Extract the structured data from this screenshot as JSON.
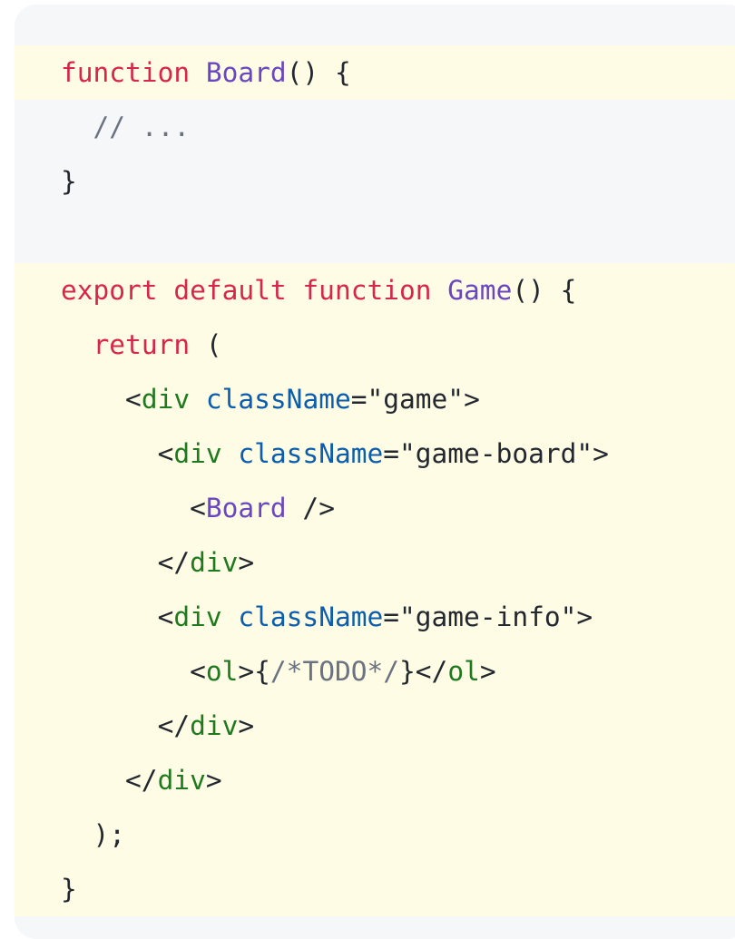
{
  "code_block": {
    "lines": [
      {
        "highlighted": true,
        "tokens": [
          {
            "text": "function ",
            "kind": "kw"
          },
          {
            "text": "Board",
            "kind": "fn"
          },
          {
            "text": "() {",
            "kind": "punc"
          }
        ]
      },
      {
        "highlighted": false,
        "tokens": [
          {
            "text": "  // ...",
            "kind": "com"
          }
        ]
      },
      {
        "highlighted": false,
        "tokens": [
          {
            "text": "}",
            "kind": "punc"
          }
        ]
      },
      {
        "highlighted": false,
        "tokens": []
      },
      {
        "highlighted": true,
        "tokens": [
          {
            "text": "export ",
            "kind": "kw"
          },
          {
            "text": "default ",
            "kind": "kw"
          },
          {
            "text": "function ",
            "kind": "kw"
          },
          {
            "text": "Game",
            "kind": "fn"
          },
          {
            "text": "() {",
            "kind": "punc"
          }
        ]
      },
      {
        "highlighted": true,
        "tokens": [
          {
            "text": "  ",
            "kind": "punc"
          },
          {
            "text": "return",
            "kind": "kw"
          },
          {
            "text": " (",
            "kind": "punc"
          }
        ]
      },
      {
        "highlighted": true,
        "tokens": [
          {
            "text": "    <",
            "kind": "punc"
          },
          {
            "text": "div",
            "kind": "tag"
          },
          {
            "text": " ",
            "kind": "punc"
          },
          {
            "text": "className",
            "kind": "attr"
          },
          {
            "text": "=",
            "kind": "punc"
          },
          {
            "text": "\"game\"",
            "kind": "str"
          },
          {
            "text": ">",
            "kind": "punc"
          }
        ]
      },
      {
        "highlighted": true,
        "tokens": [
          {
            "text": "      <",
            "kind": "punc"
          },
          {
            "text": "div",
            "kind": "tag"
          },
          {
            "text": " ",
            "kind": "punc"
          },
          {
            "text": "className",
            "kind": "attr"
          },
          {
            "text": "=",
            "kind": "punc"
          },
          {
            "text": "\"game-board\"",
            "kind": "str"
          },
          {
            "text": ">",
            "kind": "punc"
          }
        ]
      },
      {
        "highlighted": true,
        "tokens": [
          {
            "text": "        <",
            "kind": "punc"
          },
          {
            "text": "Board",
            "kind": "fn"
          },
          {
            "text": " />",
            "kind": "punc"
          }
        ]
      },
      {
        "highlighted": true,
        "tokens": [
          {
            "text": "      </",
            "kind": "punc"
          },
          {
            "text": "div",
            "kind": "tag"
          },
          {
            "text": ">",
            "kind": "punc"
          }
        ]
      },
      {
        "highlighted": true,
        "tokens": [
          {
            "text": "      <",
            "kind": "punc"
          },
          {
            "text": "div",
            "kind": "tag"
          },
          {
            "text": " ",
            "kind": "punc"
          },
          {
            "text": "className",
            "kind": "attr"
          },
          {
            "text": "=",
            "kind": "punc"
          },
          {
            "text": "\"game-info\"",
            "kind": "str"
          },
          {
            "text": ">",
            "kind": "punc"
          }
        ]
      },
      {
        "highlighted": true,
        "tokens": [
          {
            "text": "        <",
            "kind": "punc"
          },
          {
            "text": "ol",
            "kind": "tag"
          },
          {
            "text": ">{",
            "kind": "punc"
          },
          {
            "text": "/*TODO*/",
            "kind": "com"
          },
          {
            "text": "}</",
            "kind": "punc"
          },
          {
            "text": "ol",
            "kind": "tag"
          },
          {
            "text": ">",
            "kind": "punc"
          }
        ]
      },
      {
        "highlighted": true,
        "tokens": [
          {
            "text": "      </",
            "kind": "punc"
          },
          {
            "text": "div",
            "kind": "tag"
          },
          {
            "text": ">",
            "kind": "punc"
          }
        ]
      },
      {
        "highlighted": true,
        "tokens": [
          {
            "text": "    </",
            "kind": "punc"
          },
          {
            "text": "div",
            "kind": "tag"
          },
          {
            "text": ">",
            "kind": "punc"
          }
        ]
      },
      {
        "highlighted": true,
        "tokens": [
          {
            "text": "  );",
            "kind": "punc"
          }
        ]
      },
      {
        "highlighted": true,
        "tokens": [
          {
            "text": "}",
            "kind": "punc"
          }
        ]
      }
    ]
  }
}
